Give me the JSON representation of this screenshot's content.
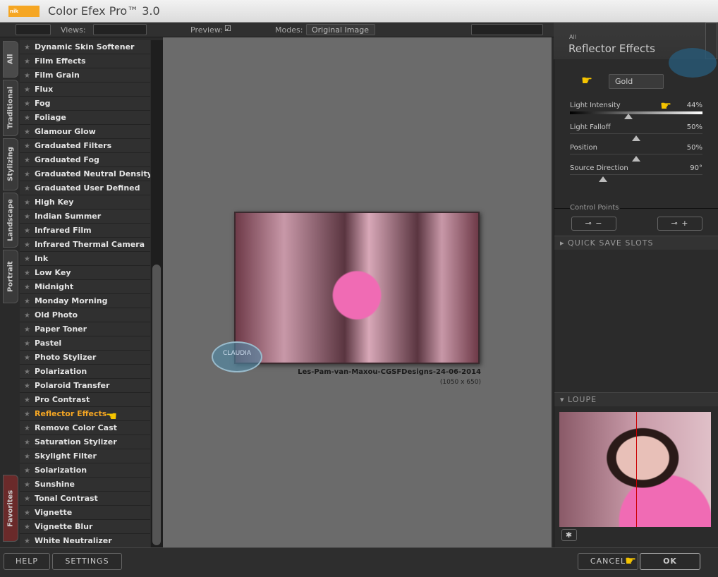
{
  "app": {
    "title": "Color Efex Pro™ 3.0",
    "logo": "nik Software"
  },
  "toolbar": {
    "views_label": "Views:",
    "preview_label": "Preview:",
    "preview_checked": true,
    "modes_label": "Modes:",
    "modes_value": "Original Image"
  },
  "tabs": [
    "All",
    "Traditional",
    "Stylizing",
    "Landscape",
    "Portrait",
    "Favorites"
  ],
  "filters": [
    "Dynamic Skin Softener",
    "Film Effects",
    "Film Grain",
    "Flux",
    "Fog",
    "Foliage",
    "Glamour Glow",
    "Graduated Filters",
    "Graduated Fog",
    "Graduated Neutral Density",
    "Graduated User Defined",
    "High Key",
    "Indian Summer",
    "Infrared Film",
    "Infrared Thermal Camera",
    "Ink",
    "Low Key",
    "Midnight",
    "Monday Morning",
    "Old Photo",
    "Paper Toner",
    "Pastel",
    "Photo Stylizer",
    "Polarization",
    "Polaroid Transfer",
    "Pro Contrast",
    "Reflector Effects",
    "Remove Color Cast",
    "Saturation Stylizer",
    "Skylight Filter",
    "Solarization",
    "Sunshine",
    "Tonal Contrast",
    "Vignette",
    "Vignette Blur",
    "White Neutralizer"
  ],
  "selected_filter": "Reflector Effects",
  "image": {
    "name": "Les-Pam-van-Maxou-CGSFDesigns-24-06-2014",
    "size": "(1050 x 650)",
    "watermark": "CLAUDIA"
  },
  "panel": {
    "category": "All",
    "title": "Reflector Effects",
    "preset": "Gold",
    "sliders": [
      {
        "label": "Light Intensity",
        "value": "44%",
        "fraction": 0.44
      },
      {
        "label": "Light Falloff",
        "value": "50%",
        "fraction": 0.5
      },
      {
        "label": "Position",
        "value": "50%",
        "fraction": 0.5
      },
      {
        "label": "Source Direction",
        "value": "90°",
        "fraction": 0.25
      }
    ],
    "control_points": "Control Points",
    "quick_save": "QUICK SAVE SLOTS",
    "loupe": "LOUPE"
  },
  "buttons": {
    "help": "HELP",
    "settings": "SETTINGS",
    "cancel": "CANCEL",
    "ok": "OK"
  },
  "colors": {
    "accent": "#f5a623",
    "preview_bg": "#6b6b6b"
  }
}
